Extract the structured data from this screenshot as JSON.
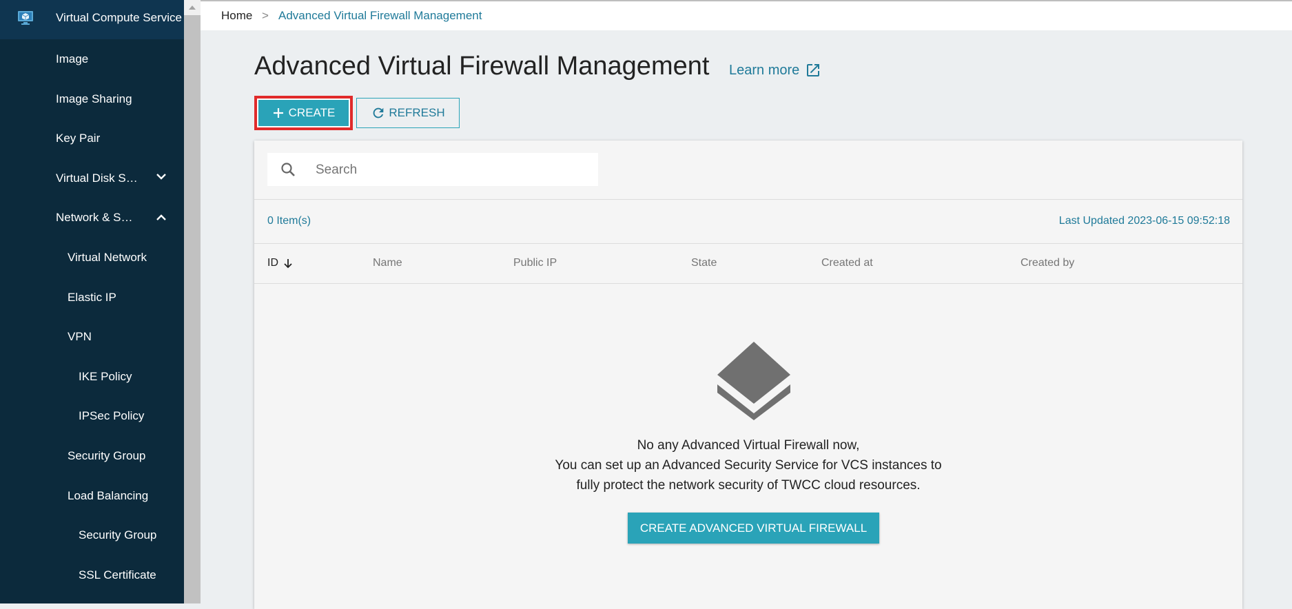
{
  "sidebar": {
    "top_label": "Virtual Compute Service",
    "items": [
      {
        "label": "Image"
      },
      {
        "label": "Image Sharing"
      },
      {
        "label": "Key Pair"
      },
      {
        "label": "Virtual Disk S…"
      },
      {
        "label": "Network & S…"
      },
      {
        "label": "Virtual Network"
      },
      {
        "label": "Elastic IP"
      },
      {
        "label": "VPN"
      },
      {
        "label": "IKE Policy"
      },
      {
        "label": "IPSec Policy"
      },
      {
        "label": "Security Group"
      },
      {
        "label": "Load Balancing"
      },
      {
        "label": "Security Group"
      },
      {
        "label": "SSL Certificate"
      }
    ]
  },
  "breadcrumb": {
    "home": "Home",
    "separator": ">",
    "current": "Advanced Virtual Firewall Management"
  },
  "page": {
    "title": "Advanced Virtual Firewall Management",
    "learn_more": "Learn more"
  },
  "toolbar": {
    "create_label": "CREATE",
    "refresh_label": "REFRESH"
  },
  "search": {
    "placeholder": "Search",
    "value": ""
  },
  "list": {
    "count_text": "0 Item(s)",
    "last_updated": "Last Updated 2023-06-15 09:52:18",
    "columns": [
      "ID",
      "Name",
      "Public IP",
      "State",
      "Created at",
      "Created by"
    ]
  },
  "empty_state": {
    "line1": "No any Advanced Virtual Firewall now,",
    "line2": "You can set up an Advanced Security Service for VCS instances to",
    "line3": "fully protect the network security of TWCC cloud resources.",
    "button_label": "CREATE ADVANCED VIRTUAL FIREWALL"
  },
  "colors": {
    "sidebar_bg": "#0c2a3c",
    "accent": "#2aa3b8",
    "link": "#1f7a99",
    "highlight_border": "#e02b2b"
  }
}
